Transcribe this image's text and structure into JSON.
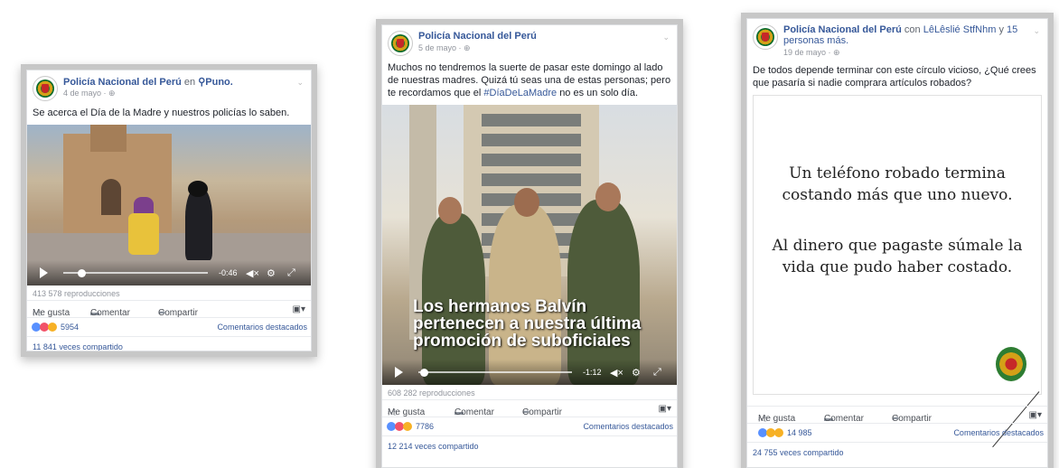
{
  "posts": [
    {
      "page_name": "Policía Nacional del Perú",
      "connector": "en",
      "location_icon": "location-pin-icon",
      "location": "Puno.",
      "date": "4 de mayo",
      "privacy_icon": "globe-icon",
      "text": "Se acerca el Día de la Madre y nuestros policías lo saben.",
      "video": {
        "time": "-0:46",
        "progress_fraction": 0.12
      },
      "views": "413 578 reproducciones",
      "actions": {
        "like": "Me gusta",
        "comment": "Comentar",
        "share": "Compartir"
      },
      "reaction_count": "5954",
      "featured_comments": "Comentarios destacados",
      "shares": "11 841 veces compartido"
    },
    {
      "page_name": "Policía Nacional del Perú",
      "date": "5 de mayo",
      "privacy_icon": "globe-icon",
      "text": "Muchos no tendremos la suerte de pasar este domingo al lado de nuestras madres. Quizá tú seas una de estas personas; pero te recordamos que el",
      "hashtag": "#DíaDeLaMadre",
      "text_end": "no es un solo día.",
      "video": {
        "overlay_lines": [
          "Los hermanos Balvín",
          "pertenecen a nuestra última",
          "promoción de suboficiales"
        ],
        "time": "-1:12",
        "progress_fraction": 0.05
      },
      "views": "608 282 reproducciones",
      "actions": {
        "like": "Me gusta",
        "comment": "Comentar",
        "share": "Compartir"
      },
      "reaction_count": "7786",
      "featured_comments": "Comentarios destacados",
      "shares": "12 214 veces compartido"
    },
    {
      "page_name": "Policía Nacional del Perú",
      "connector": "con",
      "tagged": "LêLêslié StfNhm",
      "connector2": "y",
      "others": "15 personas más.",
      "date": "19 de mayo",
      "privacy_icon": "globe-icon",
      "text": "De todos depende terminar con este círculo vicioso, ¿Qué crees que pasaría si nadie comprara artículos robados?",
      "image": {
        "line1": "Un teléfono robado termina",
        "line2": "costando más que uno nuevo.",
        "line3": "Al dinero que pagaste súmale la",
        "line4": "vida que pudo haber costado."
      },
      "actions": {
        "like": "Me gusta",
        "comment": "Comentar",
        "share": "Compartir"
      },
      "reaction_count": "14 985",
      "featured_comments": "Comentarios destacados",
      "shares": "24 755 veces compartido"
    }
  ],
  "colors": {
    "link": "#365899",
    "like": "#5890ff",
    "love": "#f25268",
    "haha": "#f7b125"
  }
}
